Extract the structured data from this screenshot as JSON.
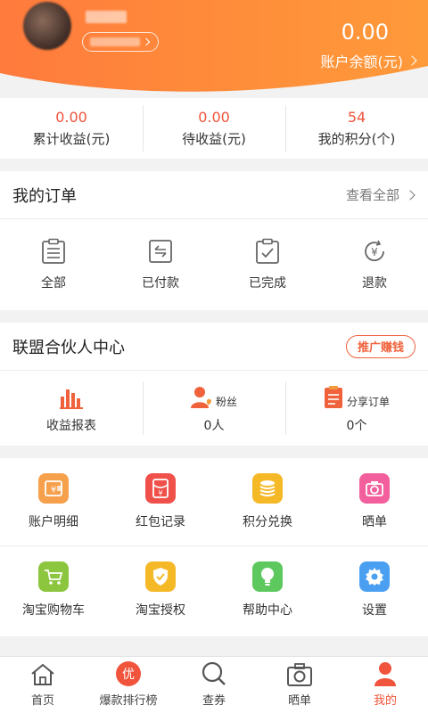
{
  "header": {
    "balance_value": "0.00",
    "balance_label": "账户余额(元)"
  },
  "stats": [
    {
      "value": "0.00",
      "label": "累计收益(元)"
    },
    {
      "value": "0.00",
      "label": "待收益(元)"
    },
    {
      "value": "54",
      "label": "我的积分(个)"
    }
  ],
  "orders": {
    "title": "我的订单",
    "see_all": "查看全部",
    "items": [
      {
        "label": "全部",
        "icon": "clipboard-list-icon"
      },
      {
        "label": "已付款",
        "icon": "payment-return-icon"
      },
      {
        "label": "已完成",
        "icon": "clipboard-check-icon"
      },
      {
        "label": "退款",
        "icon": "yen-refund-icon"
      }
    ]
  },
  "alliance": {
    "title": "联盟合伙人中心",
    "promo_button": "推广赚钱",
    "items": [
      {
        "label": "收益报表",
        "icon": "bar-chart-icon"
      },
      {
        "caption": "粉丝",
        "value": "0人",
        "icon": "user-heart-icon"
      },
      {
        "caption": "分享订单",
        "value": "0个",
        "icon": "order-list-icon"
      }
    ]
  },
  "grid": {
    "row1": [
      {
        "label": "账户明细",
        "icon": "wallet-icon",
        "color": "#f7a04c"
      },
      {
        "label": "红包记录",
        "icon": "red-envelope-icon",
        "color": "#f0504a"
      },
      {
        "label": "积分兑换",
        "icon": "coins-stack-icon",
        "color": "#f5b827"
      },
      {
        "label": "晒单",
        "icon": "camera-icon",
        "color": "#f25f9c"
      }
    ],
    "row2": [
      {
        "label": "淘宝购物车",
        "icon": "cart-icon",
        "color": "#8cc63f"
      },
      {
        "label": "淘宝授权",
        "icon": "shield-check-icon",
        "color": "#f5b827"
      },
      {
        "label": "帮助中心",
        "icon": "lightbulb-icon",
        "color": "#5cc85e"
      },
      {
        "label": "设置",
        "icon": "gear-icon",
        "color": "#4a9ff0"
      }
    ]
  },
  "tabs": [
    {
      "label": "首页",
      "icon": "home-icon"
    },
    {
      "label": "爆款排行榜",
      "icon": "you-badge-icon",
      "badge": "优"
    },
    {
      "label": "查券",
      "icon": "search-icon"
    },
    {
      "label": "晒单",
      "icon": "camera-icon"
    },
    {
      "label": "我的",
      "icon": "user-icon",
      "active": true
    }
  ],
  "colors": {
    "accent": "#f0543c",
    "header_gradient_start": "#ff7a3d",
    "header_gradient_end": "#ff9a3a"
  }
}
